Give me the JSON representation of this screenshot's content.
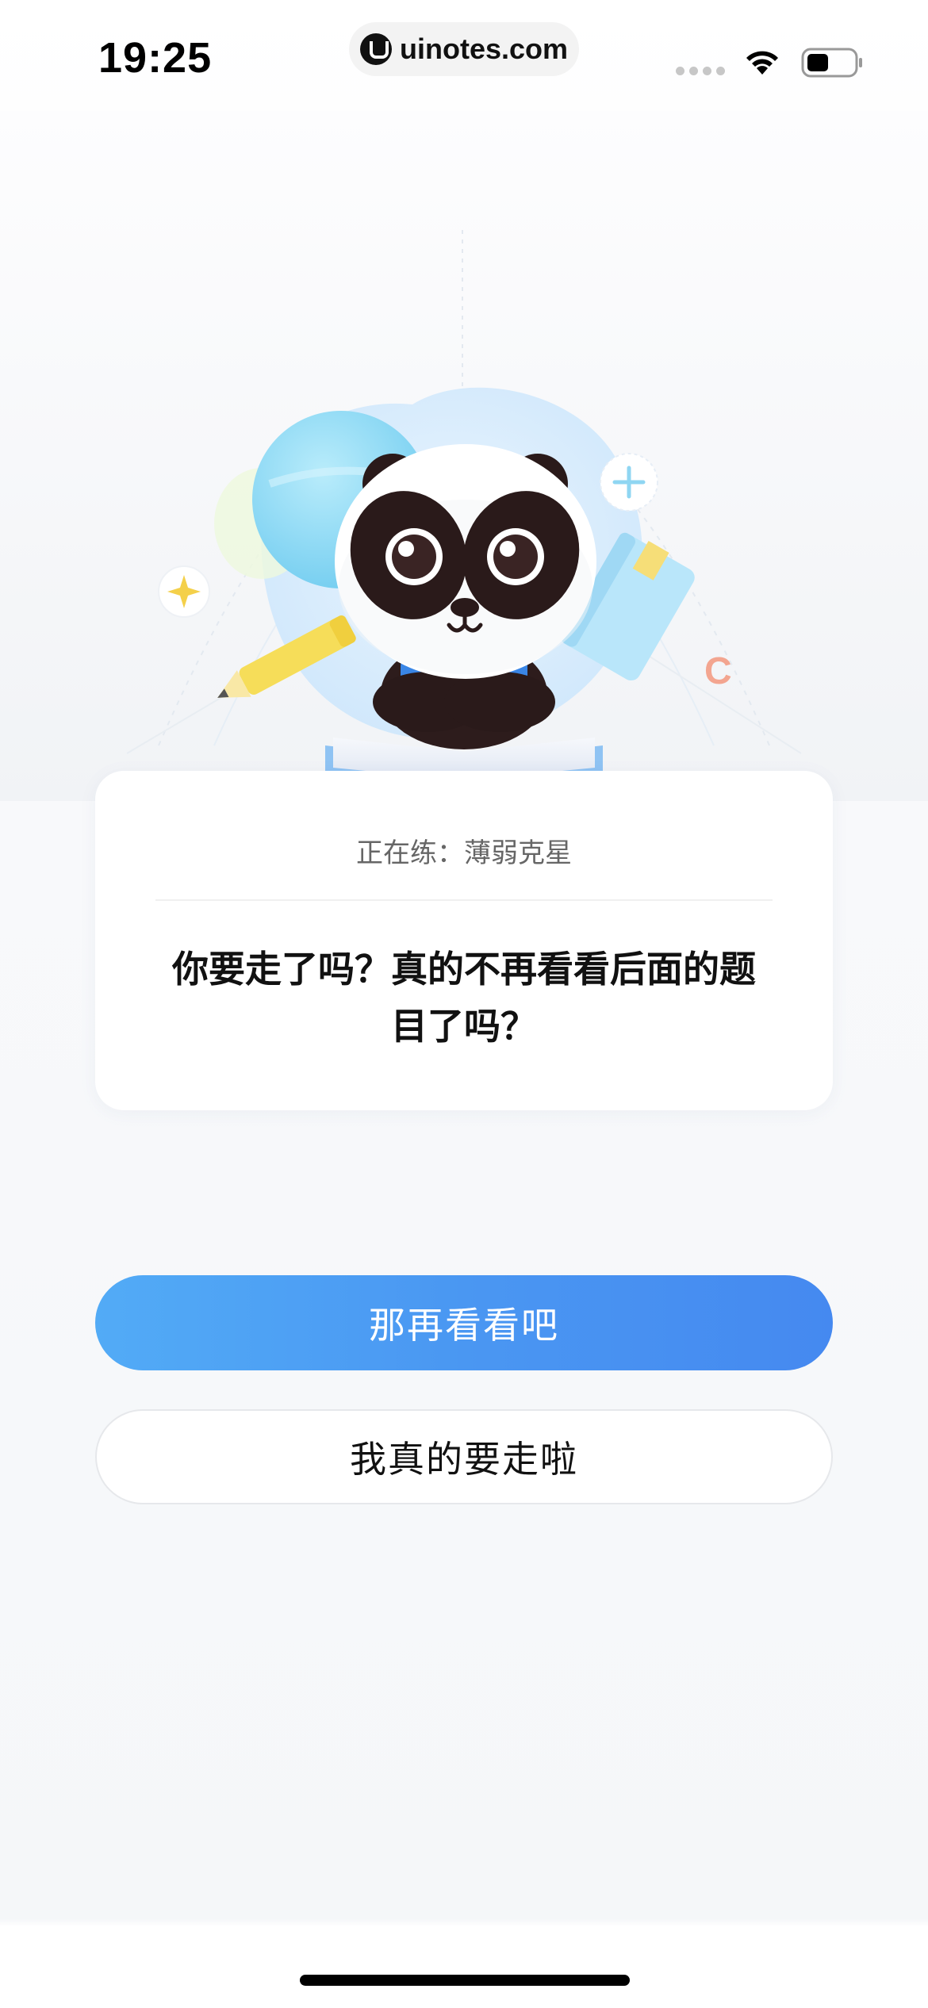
{
  "status_bar": {
    "time": "19:25",
    "url": "uinotes.com",
    "icons": [
      "signal-icon",
      "wifi-icon",
      "battery-icon"
    ]
  },
  "hero": {
    "illustration": "panda-reading-book",
    "decorations": [
      "sparkle-star-icon",
      "plus-icon",
      "letter-c-icon",
      "pencil-icon",
      "book-icon"
    ]
  },
  "card": {
    "practice_label": "正在练：薄弱克星",
    "question_line1": "你要走了吗？真的不再看看后面的题",
    "question_line2": "目了吗？"
  },
  "buttons": {
    "stay_label": "那再看看吧",
    "leave_label": "我真的要走啦"
  },
  "colors": {
    "primary_gradient_start": "#52abf6",
    "primary_gradient_end": "#4589f0",
    "text_primary": "#111111",
    "text_secondary": "#666666"
  }
}
